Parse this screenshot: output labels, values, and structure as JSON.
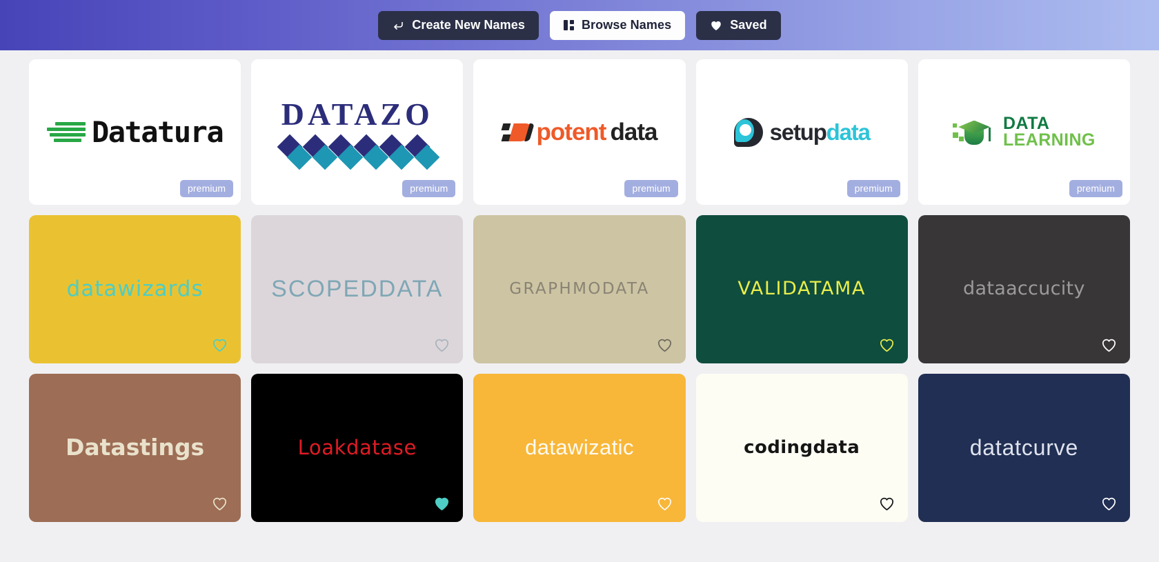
{
  "header": {
    "buttons": [
      {
        "label": "Create New Names",
        "icon": "back-arrow-icon",
        "style": "dark"
      },
      {
        "label": "Browse Names",
        "icon": "grid-icon",
        "style": "light"
      },
      {
        "label": "Saved",
        "icon": "heart-icon",
        "style": "dark"
      }
    ],
    "gradient_from": "#4744b8",
    "gradient_to": "#adbcf0"
  },
  "logo_cards": [
    {
      "name": "Datatura",
      "badge": "premium",
      "colors": {
        "text": "#111111",
        "accent": "#28a745"
      }
    },
    {
      "name": "DATAZO",
      "badge": "premium",
      "colors": {
        "text": "#2c2d7a",
        "accent": "#1d97b4"
      }
    },
    {
      "name": "potentdata",
      "badge": "premium",
      "colors": {
        "text": "#222222",
        "accent": "#ef5a28"
      },
      "part_a": "potent",
      "part_b": "data"
    },
    {
      "name": "setupdata",
      "badge": "premium",
      "colors": {
        "text": "#26282f",
        "accent": "#2cc4d8"
      },
      "part_a": "setup",
      "part_b": "data"
    },
    {
      "name": "DATA LEARNING",
      "badge": "premium",
      "colors": {
        "text": "#117a43",
        "accent": "#6fc04a"
      },
      "part_a": "DATA",
      "part_b": "LEARNING"
    }
  ],
  "name_cards": [
    {
      "label": "datawizards",
      "bg": "#eac231",
      "fg": "#4ecdc4",
      "font": "f-round",
      "size": "31px",
      "spacing": "1px",
      "case": "lowercase",
      "heart": "#4ecdc4",
      "saved": false
    },
    {
      "label": "SCOPEDDATA",
      "bg": "#dcd6da",
      "fg": "#7fa7b5",
      "font": "f-cond",
      "size": "34px",
      "spacing": "2px",
      "case": "uppercase",
      "heart": "#a9b3bb",
      "saved": false
    },
    {
      "label": "GRAPHMODATA",
      "bg": "#cdc4a3",
      "fg": "#8a8374",
      "font": "f-round",
      "size": "23px",
      "spacing": "2.4px",
      "case": "uppercase",
      "heart": "#6f6a5e",
      "saved": false
    },
    {
      "label": "VALIDATAMA",
      "bg": "#0f4d3f",
      "fg": "#eaee4a",
      "font": "f-round",
      "size": "27px",
      "spacing": "1.6px",
      "case": "uppercase",
      "heart": "#eaee4a",
      "saved": false
    },
    {
      "label": "dataaccucity",
      "bg": "#393638",
      "fg": "#9b9b9b",
      "font": "f-round",
      "size": "27px",
      "spacing": "0.3px",
      "case": "lowercase",
      "heart": "#ffffff",
      "saved": false
    },
    {
      "label": "Datastings",
      "bg": "#9d6d55",
      "fg": "#e9e1cb",
      "font": "f-bold",
      "size": "33px",
      "spacing": "0px",
      "case": "none",
      "heart": "#e9e1cb",
      "saved": false
    },
    {
      "label": "Loakdatase",
      "bg": "#000000",
      "fg": "#e01b24",
      "font": "f-round",
      "size": "29px",
      "spacing": "0.6px",
      "case": "none",
      "heart": "#4ecdc4",
      "saved": true
    },
    {
      "label": "datawizatic",
      "bg": "#f8b739",
      "fg": "#fdfaf2",
      "font": "f-cond",
      "size": "31px",
      "spacing": "0.4px",
      "case": "lowercase",
      "heart": "#fdfaf2",
      "saved": false
    },
    {
      "label": "codingdata",
      "bg": "#fdfdf4",
      "fg": "#151515",
      "font": "f-bold",
      "size": "26px",
      "spacing": "0.4px",
      "case": "lowercase",
      "heart": "#151515",
      "saved": false
    },
    {
      "label": "datatcurve",
      "bg": "#212f54",
      "fg": "#dfe3ee",
      "font": "f-cond",
      "size": "32px",
      "spacing": "0.8px",
      "case": "lowercase",
      "heart": "#ffffff",
      "saved": false
    }
  ]
}
